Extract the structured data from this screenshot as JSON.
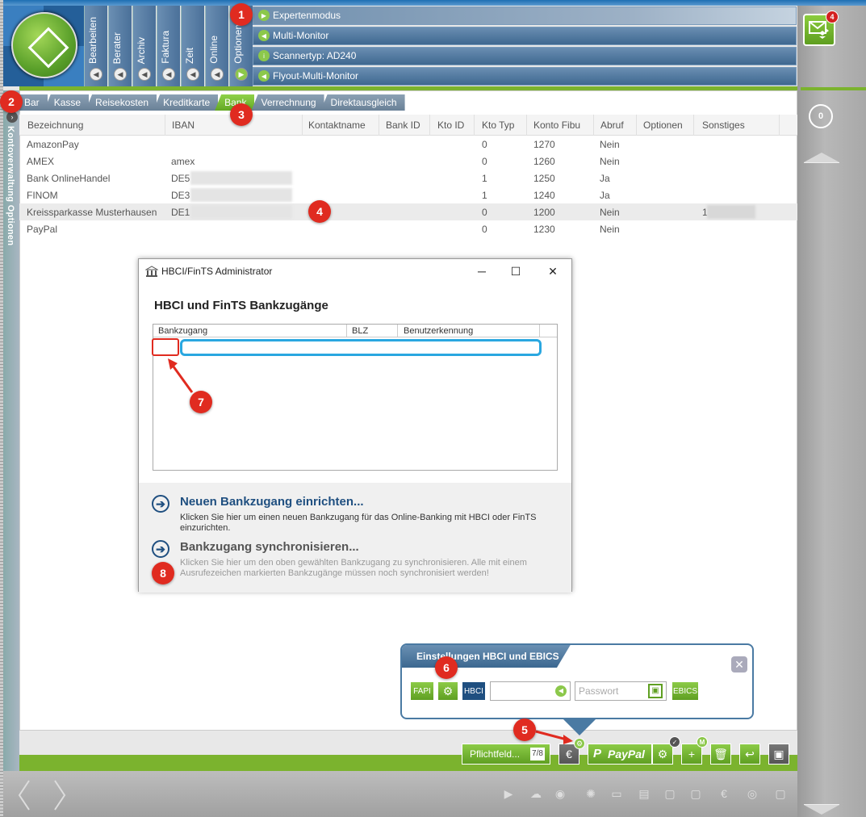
{
  "nav_tabs": [
    {
      "label": "Bearbeiten"
    },
    {
      "label": "Berater"
    },
    {
      "label": "Archiv"
    },
    {
      "label": "Faktura"
    },
    {
      "label": "Zeit"
    },
    {
      "label": "Online"
    },
    {
      "label": "Optionen"
    }
  ],
  "options_menu": [
    "Expertenmodus",
    "Multi-Monitor",
    "Scannertyp: AD240",
    "Flyout-Multi-Monitor"
  ],
  "notifications": {
    "count": "4"
  },
  "right_counter": "0",
  "side_panel": {
    "label": "Kontoverwaltung Optionen"
  },
  "tabs": [
    {
      "label": "Bar",
      "active": false
    },
    {
      "label": "Kasse",
      "active": false
    },
    {
      "label": "Reisekosten",
      "active": false
    },
    {
      "label": "Kreditkarte",
      "active": false
    },
    {
      "label": "Bank",
      "active": true
    },
    {
      "label": "Verrechnung",
      "active": false
    },
    {
      "label": "Direktausgleich",
      "active": false
    }
  ],
  "table": {
    "columns": [
      "Bezeichnung",
      "IBAN",
      "Kontaktname",
      "Bank ID",
      "Kto ID",
      "Kto Typ",
      "Konto Fibu",
      "Abruf",
      "Optionen",
      "Sonstiges"
    ],
    "rows": [
      {
        "name": "AmazonPay",
        "iban": "",
        "typ": "0",
        "fibu": "1270",
        "abruf": "Nein",
        "sonst": ""
      },
      {
        "name": "AMEX",
        "iban": "amex",
        "typ": "0",
        "fibu": "1260",
        "abruf": "Nein",
        "sonst": ""
      },
      {
        "name": "Bank OnlineHandel",
        "iban": "DE5",
        "typ": "1",
        "fibu": "1250",
        "abruf": "Ja",
        "sonst": ""
      },
      {
        "name": "FINOM",
        "iban": "DE3",
        "typ": "1",
        "fibu": "1240",
        "abruf": "Ja",
        "sonst": ""
      },
      {
        "name": "Kreissparkasse Musterhausen",
        "iban": "DE1",
        "typ": "0",
        "fibu": "1200",
        "abruf": "Nein",
        "sonst": "1"
      },
      {
        "name": "PayPal",
        "iban": "",
        "typ": "0",
        "fibu": "1230",
        "abruf": "Nein",
        "sonst": ""
      }
    ]
  },
  "dialog": {
    "title": "HBCI/FinTS Administrator",
    "heading": "HBCI und FinTS Bankzugänge",
    "columns": [
      "Bankzugang",
      "BLZ",
      "Benutzerkennung"
    ],
    "action1_title": "Neuen Bankzugang einrichten...",
    "action1_desc": "Klicken Sie hier um einen neuen Bankzugang für das Online-Banking mit HBCI oder FinTS einzurichten.",
    "action2_title": "Bankzugang synchronisieren...",
    "action2_desc": "Klicken Sie hier um den oben gewählten Bankzugang zu synchronisieren. Alle mit einem Ausrufezeichen markierten Bankzugänge müssen noch synchronisiert werden!"
  },
  "popover": {
    "title": "Einstellungen HBCI und EBICS",
    "fapi": "FAPI",
    "hbci": "HBCI",
    "password_placeholder": "Passwort",
    "ebics": "EBICS"
  },
  "toolbar": {
    "pflicht_label": "Pflichtfeld...",
    "pflicht_num": "7/8",
    "paypal_label": "PayPal",
    "add_badge": "M"
  },
  "markers": [
    "1",
    "2",
    "3",
    "4",
    "5",
    "6",
    "7",
    "8"
  ],
  "colors": {
    "accent_green": "#7bb32e",
    "primary_blue": "#3f6890",
    "marker_red": "#e02b20",
    "highlight_cyan": "#2aa7e0"
  }
}
